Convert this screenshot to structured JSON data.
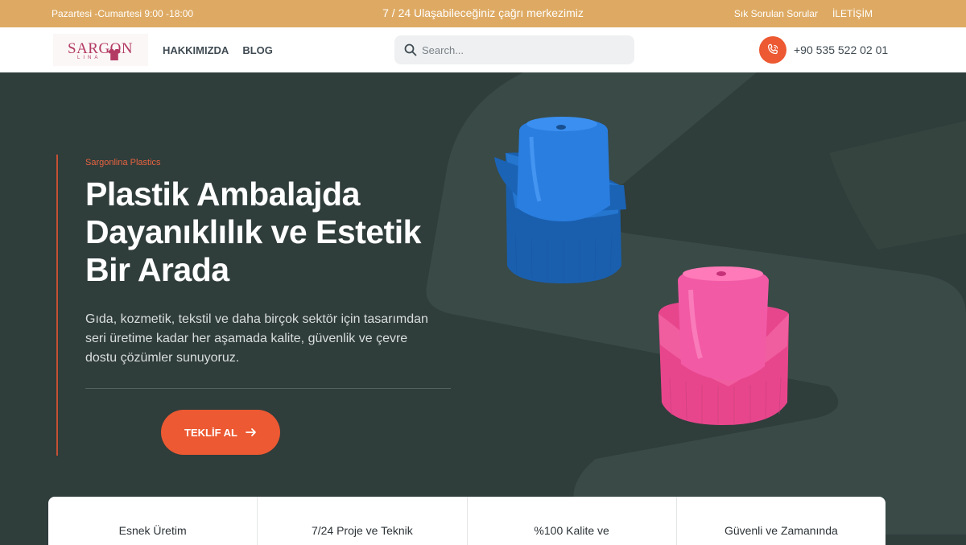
{
  "topbar": {
    "hours": "Pazartesi -Cumartesi 9:00 -18:00",
    "callcenter": "7 / 24 Ulaşabileceğiniz çağrı merkezimiz",
    "links": [
      "Sık Sorulan Sorular",
      "İLETİŞİM"
    ]
  },
  "navbar": {
    "logo_text": "SARGON",
    "logo_sub": "LINA",
    "links": [
      "HAKKIMIZDA",
      "BLOG"
    ],
    "search_placeholder": "Search...",
    "phone": "+90 535 522 02 01"
  },
  "hero": {
    "eyebrow": "Sargonlina Plastics",
    "headline": "Plastik Ambalajda Dayanıklılık ve Estetik Bir Arada",
    "description": "Gıda, kozmetik, tekstil ve daha birçok sektör için tasarımdan seri üretime kadar her aşamada kalite, güvenlik ve çevre dostu çözümler sunuyoruz.",
    "cta_label": "TEKLİF AL"
  },
  "features": [
    "Esnek Üretim",
    "7/24 Proje ve Teknik",
    "%100 Kalite ve",
    "Güvenli ve Zamanında"
  ],
  "colors": {
    "topbar": "#deaa63",
    "hero_bg": "#2f3d3b",
    "accent": "#ec5932",
    "cap_blue": "#1f6fc4",
    "cap_pink": "#f0559e"
  },
  "icons": [
    "search-icon",
    "phone-icon",
    "arrow-right-icon"
  ]
}
